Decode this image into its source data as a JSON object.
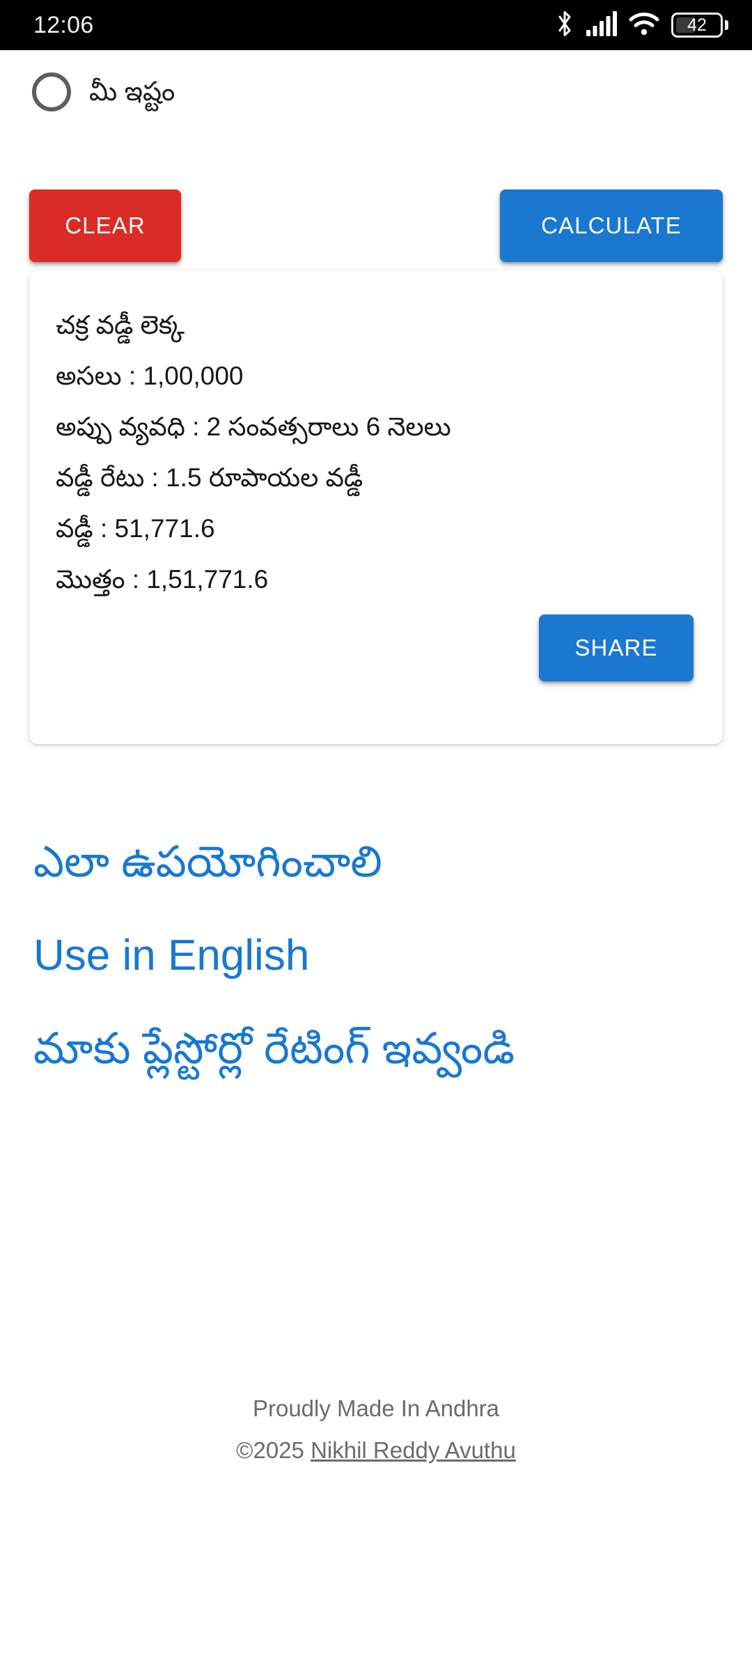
{
  "status_bar": {
    "time": "12:06",
    "icons": [
      "bluetooth-icon",
      "signal-icon",
      "wifi-icon",
      "battery-icon"
    ],
    "battery_level": "42"
  },
  "options": {
    "radio_label": "మీ ఇష్టం",
    "radio_selected": false
  },
  "actions": {
    "clear_label": "CLEAR",
    "calculate_label": "CALCULATE",
    "share_label": "SHARE"
  },
  "result_card": {
    "title": "చక్ర వడ్డీ లెక్క",
    "lines": [
      "అసలు : 1,00,000",
      "అప్పు వ్యవధి : 2 సంవత్సరాలు 6 నెలలు",
      "వడ్డీ రేటు : 1.5 రూపాయల వడ్డీ",
      "వడ్డీ : 51,771.6",
      "మొత్తం : 1,51,771.6"
    ],
    "principal": "1,00,000",
    "duration": "2 సంవత్సరాలు 6 నెలలు",
    "rate": "1.5 రూపాయల వడ్డీ",
    "interest": "51,771.6",
    "total": "1,51,771.6"
  },
  "links": {
    "how_to_use_telugu": "ఎలా ఉపయోగించాలి",
    "use_in_english": "Use in English",
    "rate_us": "మాకు ప్లేస్టోర్లో రేటింగ్ ఇవ్వండి"
  },
  "footer": {
    "made_in": "Proudly Made In Andhra",
    "copyright": "©2025 ",
    "author": "Nikhil Reddy Avuthu"
  },
  "colors": {
    "accent_blue": "#1B78D0",
    "danger_red": "#DB2B27",
    "link_blue": "#1877D2",
    "text_dark": "#161616",
    "footer_gray": "#6b6b6b"
  }
}
